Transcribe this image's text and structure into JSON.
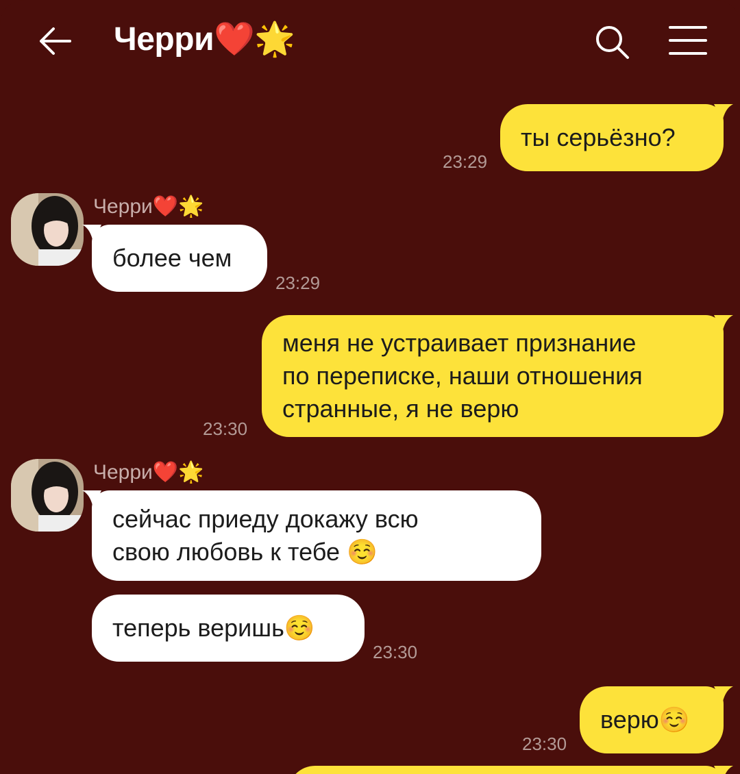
{
  "header": {
    "title": "Черри❤️🌟",
    "back_icon": "arrow-left-icon",
    "search_icon": "search-icon",
    "menu_icon": "hamburger-menu-icon"
  },
  "colors": {
    "background": "#4a0e0b",
    "outgoing_bubble": "#fde23a",
    "incoming_bubble": "#ffffff",
    "time_text": "#b39a96"
  },
  "messages": [
    {
      "direction": "out",
      "text": "ты серьёзно?",
      "time": "23:29"
    },
    {
      "direction": "in",
      "sender": "Черри❤️🌟",
      "text": "более чем",
      "time": "23:29"
    },
    {
      "direction": "out",
      "text": "меня не устраивает признание\nпо переписке, наши отношения\nстранные, я не верю",
      "time": "23:30"
    },
    {
      "direction": "in",
      "sender": "Черри❤️🌟",
      "text": "сейчас приеду докажу всю\nсвою любовь к тебе ☺️"
    },
    {
      "direction": "in",
      "text": "теперь веришь☺️",
      "time": "23:30"
    },
    {
      "direction": "out",
      "text": "верю☺️",
      "time": "23:30"
    }
  ]
}
